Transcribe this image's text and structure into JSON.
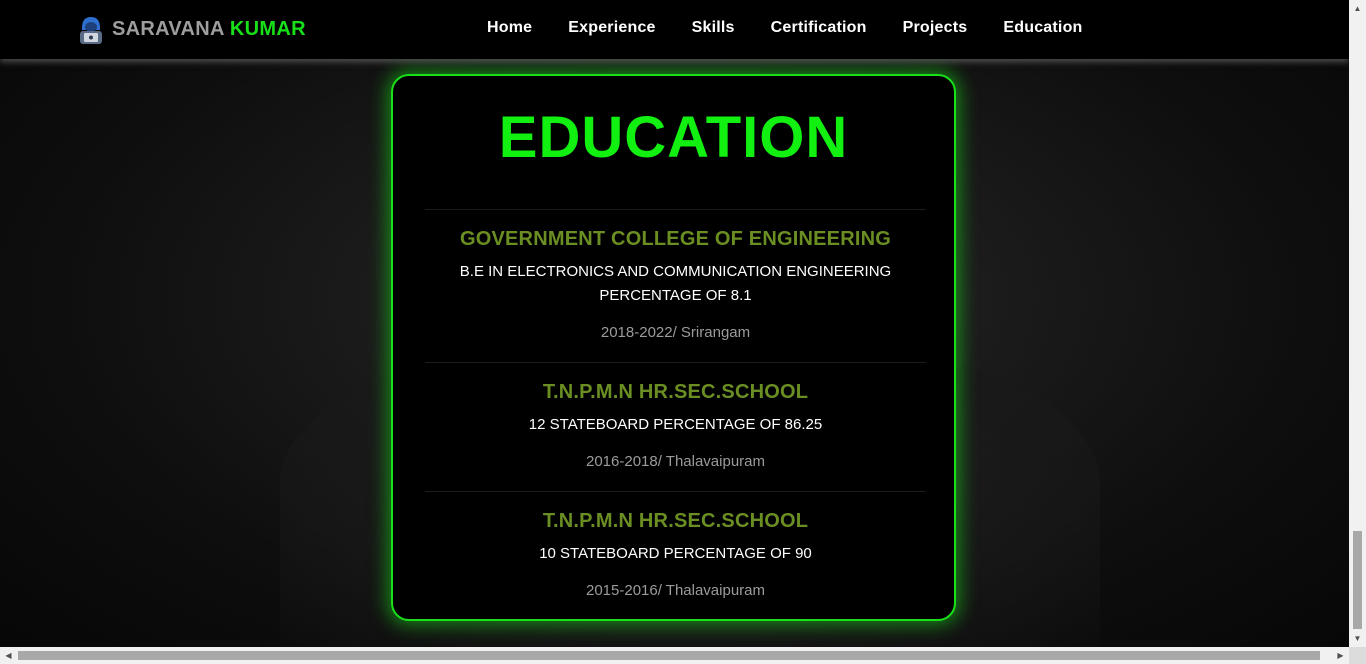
{
  "brand": {
    "first_name": "SARAVANA",
    "last_name": "KUMAR",
    "logo_icon": "hacker-avatar-icon"
  },
  "nav": {
    "items": [
      {
        "label": "Home"
      },
      {
        "label": "Experience"
      },
      {
        "label": "Skills"
      },
      {
        "label": "Certification"
      },
      {
        "label": "Projects"
      },
      {
        "label": "Education"
      }
    ]
  },
  "education": {
    "title": "EDUCATION",
    "entries": [
      {
        "school": "GOVERNMENT COLLEGE OF ENGINEERING",
        "degree_line1": "B.E IN ELECTRONICS AND COMMUNICATION ENGINEERING",
        "degree_line2": "PERCENTAGE OF 8.1",
        "meta": "2018-2022/ Srirangam"
      },
      {
        "school": "T.N.P.M.N HR.SEC.SCHOOL",
        "degree_line1": "12 STATEBOARD PERCENTAGE OF 86.25",
        "meta": "2016-2018/ Thalavaipuram"
      },
      {
        "school": "T.N.P.M.N HR.SEC.SCHOOL",
        "degree_line1": "10 STATEBOARD PERCENTAGE OF 90",
        "meta": "2015-2016/ Thalavaipuram"
      }
    ]
  },
  "colors": {
    "accent_green": "#19e019",
    "school_green": "#6b8e23",
    "brand_grey": "#9e9e9e"
  },
  "scrollbars": {
    "vertical_position_fraction": 0.9,
    "horizontal_position_fraction": 0.0
  }
}
